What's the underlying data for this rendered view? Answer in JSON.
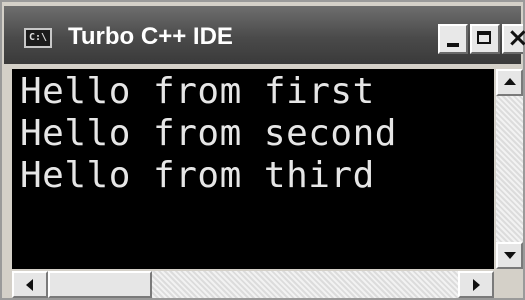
{
  "window": {
    "title": "Turbo C++ IDE",
    "icon": {
      "name": "console-window-icon",
      "text": "C:\\"
    }
  },
  "titlebar_buttons": {
    "minimize_glyph": "minimize-icon",
    "maximize_glyph": "maximize-icon",
    "close_glyph": "×"
  },
  "console": {
    "background": "#000000",
    "foreground": "#e6e6e6",
    "lines": [
      "Hello from first",
      "Hello from second",
      "Hello from third"
    ]
  },
  "scrollbars": {
    "vertical": {
      "up_icon": "arrow-up-icon",
      "down_icon": "arrow-down-icon"
    },
    "horizontal": {
      "left_icon": "arrow-left-icon",
      "right_icon": "arrow-right-icon"
    }
  }
}
